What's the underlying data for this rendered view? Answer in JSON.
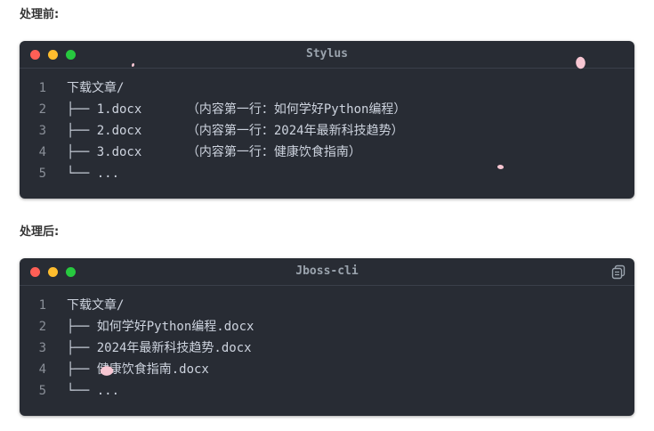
{
  "before": {
    "label": "处理前:",
    "title": "Stylus",
    "lines": [
      {
        "n": "1",
        "text": "下载文章/"
      },
      {
        "n": "2",
        "text": "├── 1.docx      （内容第一行：如何学好Python编程）"
      },
      {
        "n": "3",
        "text": "├── 2.docx      （内容第一行：2024年最新科技趋势）"
      },
      {
        "n": "4",
        "text": "├── 3.docx      （内容第一行：健康饮食指南）"
      },
      {
        "n": "5",
        "text": "└── ..."
      }
    ]
  },
  "after": {
    "label": "处理后:",
    "title": "Jboss-cli",
    "copy_icon": "copy-icon",
    "lines": [
      {
        "n": "1",
        "text": "下载文章/"
      },
      {
        "n": "2",
        "text": "├── 如何学好Python编程.docx"
      },
      {
        "n": "3",
        "text": "├── 2024年最新科技趋势.docx"
      },
      {
        "n": "4",
        "text": "├── 健康饮食指南.docx"
      },
      {
        "n": "5",
        "text": "└── ..."
      }
    ]
  },
  "colors": {
    "panel_bg": "#282c34",
    "red": "#ff5f56",
    "yellow": "#ffbd2e",
    "green": "#27c93f",
    "code_text": "#cdd3de",
    "petal": "#f7c6d2"
  }
}
